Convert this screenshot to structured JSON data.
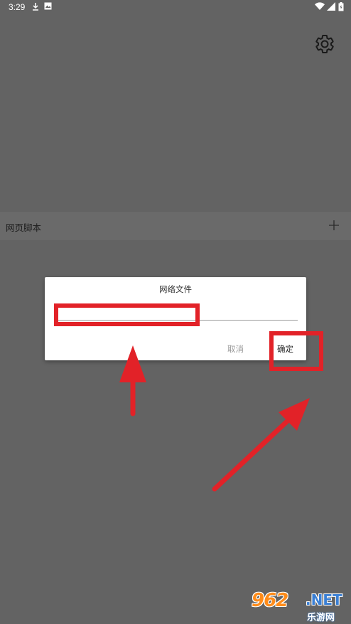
{
  "status_bar": {
    "time": "3:29",
    "icons_left": [
      "download-icon",
      "image-icon"
    ],
    "icons_right": [
      "wifi-icon",
      "signal-icon",
      "battery-icon"
    ]
  },
  "toolbar": {
    "settings_icon": "gear-icon"
  },
  "section": {
    "title": "网页脚本",
    "add_icon": "plus-icon"
  },
  "dialog": {
    "title": "网络文件",
    "input_value": "",
    "input_placeholder": "",
    "cancel_label": "取消",
    "ok_label": "确定"
  },
  "annotations": {
    "color": "#e22228",
    "targets": [
      "input-field",
      "ok-button"
    ]
  },
  "watermark": {
    "number": "962",
    "suffix": ".NET",
    "subtitle": "乐游网"
  },
  "colors": {
    "background": "#636363",
    "dialog": "#ffffff",
    "accent_red": "#e22228"
  }
}
